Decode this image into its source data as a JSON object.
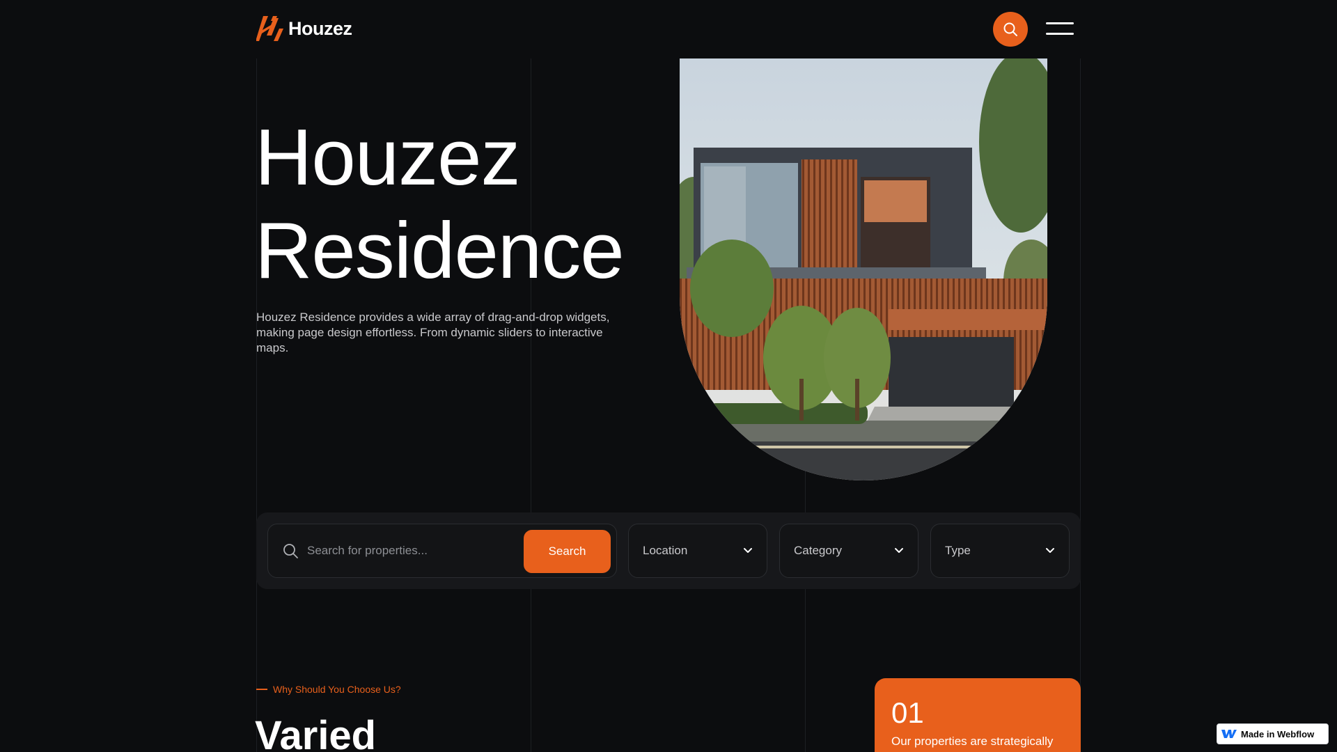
{
  "brand": {
    "name": "Houzez",
    "accent": "#e8601c",
    "background": "#0c0d0f"
  },
  "header": {
    "search_icon": "search-icon",
    "menu_icon": "hamburger-icon"
  },
  "hero": {
    "title_line1": "Houzez",
    "title_line2": "Residence",
    "description": "Houzez Residence provides a wide array of drag-and-drop widgets, making page design effortless. From dynamic sliders to interactive maps."
  },
  "search": {
    "placeholder": "Search for properties...",
    "button_label": "Search",
    "location_label": "Location",
    "category_label": "Category",
    "type_label": "Type"
  },
  "why": {
    "label": "Why Should You Choose Us?",
    "title": "Varied"
  },
  "feature_card": {
    "number": "01",
    "text": "Our properties are strategically"
  },
  "badge": {
    "label": "Made in Webflow"
  }
}
